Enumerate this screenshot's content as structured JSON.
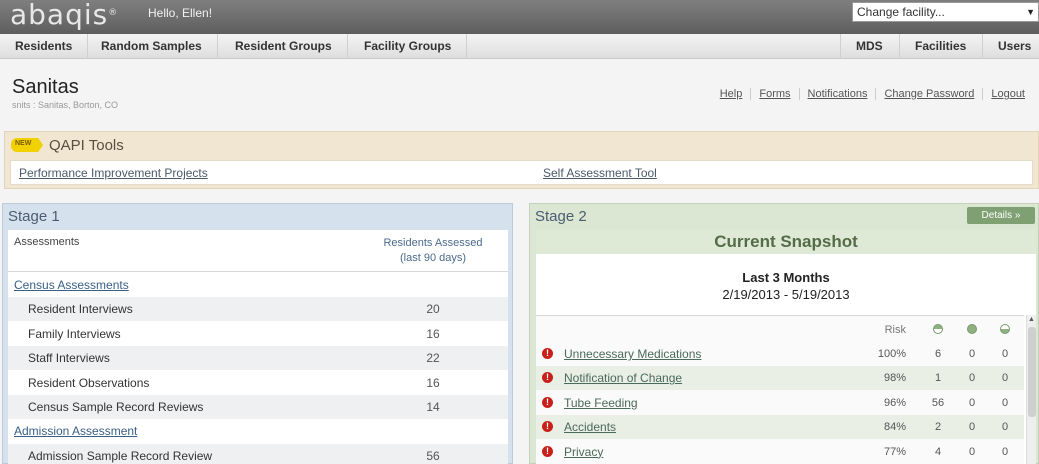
{
  "app": {
    "logo": "abaqis",
    "logo_mark": "®",
    "greeting": "Hello, Ellen!"
  },
  "facility_select": {
    "value": "Change facility..."
  },
  "nav": {
    "left": [
      "Residents",
      "Random Samples",
      "Resident Groups",
      "Facility Groups"
    ],
    "right": [
      "MDS",
      "Facilities",
      "Users"
    ]
  },
  "facility": {
    "name": "Sanitas",
    "sub": "snits : Sanitas, Borton, CO"
  },
  "toplinks": [
    "Help",
    "Forms",
    "Notifications",
    "Change Password",
    "Logout"
  ],
  "qapi": {
    "badge": "NEW",
    "title": "QAPI Tools",
    "links": [
      "Performance Improvement Projects",
      "Self Assessment Tool"
    ]
  },
  "stage1": {
    "title": "Stage 1",
    "col_left": "Assessments",
    "col_right_1": "Residents Assessed",
    "col_right_2": "(last 90 days)",
    "rows": [
      {
        "label": "Census Assessments",
        "value": ""
      },
      {
        "label": "Resident Interviews",
        "value": "20"
      },
      {
        "label": "Family Interviews",
        "value": "16"
      },
      {
        "label": "Staff Interviews",
        "value": "22"
      },
      {
        "label": "Resident Observations",
        "value": "16"
      },
      {
        "label": "Census Sample Record Reviews",
        "value": "14"
      },
      {
        "label": "Admission Assessment",
        "value": ""
      },
      {
        "label": "Admission Sample Record Review",
        "value": "56"
      }
    ]
  },
  "stage2": {
    "title": "Stage 2",
    "details": "Details »",
    "snapshot_title": "Current Snapshot",
    "period": "Last 3 Months",
    "dates": "2/19/2013 - 5/19/2013",
    "risk_label": "Risk",
    "alert_glyph": "!",
    "status_colors": {
      "icon": "#8fb07f",
      "alert": "#c8201a"
    },
    "rows": [
      {
        "name": "Unnecessary Medications",
        "risk": "100%",
        "a": "6",
        "b": "0",
        "c": "0"
      },
      {
        "name": "Notification of Change",
        "risk": "98%",
        "a": "1",
        "b": "0",
        "c": "0"
      },
      {
        "name": "Tube Feeding",
        "risk": "96%",
        "a": "56",
        "b": "0",
        "c": "0"
      },
      {
        "name": "Accidents",
        "risk": "84%",
        "a": "2",
        "b": "0",
        "c": "0"
      },
      {
        "name": "Privacy",
        "risk": "77%",
        "a": "4",
        "b": "0",
        "c": "0"
      }
    ]
  }
}
